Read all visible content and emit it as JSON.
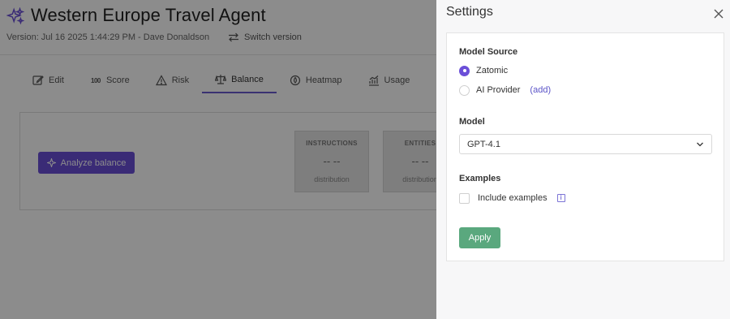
{
  "header": {
    "title": "Western Europe Travel Agent",
    "version": "Version: Jul 16 2025 1:44:29 PM - Dave Donaldson",
    "switch_version": "Switch version"
  },
  "tabs": [
    {
      "label": "Edit",
      "icon": "edit-icon"
    },
    {
      "label": "Score",
      "icon": "score-100-icon"
    },
    {
      "label": "Risk",
      "icon": "warning-icon"
    },
    {
      "label": "Balance",
      "icon": "scale-icon",
      "active": true
    },
    {
      "label": "Heatmap",
      "icon": "heatmap-icon"
    },
    {
      "label": "Usage",
      "icon": "chart-icon"
    }
  ],
  "analyze": {
    "label": "Analyze balance"
  },
  "metrics": [
    {
      "title": "INSTRUCTIONS",
      "value": "-- --",
      "sub": "distribution"
    },
    {
      "title": "ENTITIES",
      "value": "-- --",
      "sub": "distribution"
    }
  ],
  "settings": {
    "title": "Settings",
    "model_source_label": "Model Source",
    "options": [
      {
        "label": "Zatomic",
        "checked": true
      },
      {
        "label": "AI Provider",
        "checked": false,
        "link": "(add)"
      }
    ],
    "model_label": "Model",
    "model_value": "GPT-4.1",
    "examples_label": "Examples",
    "include_examples": "Include examples",
    "include_examples_checked": false,
    "apply": "Apply"
  },
  "colors": {
    "accent": "#6b4fd8",
    "apply": "#5aa87e",
    "overlay": "rgba(0,0,0,0.45)"
  }
}
